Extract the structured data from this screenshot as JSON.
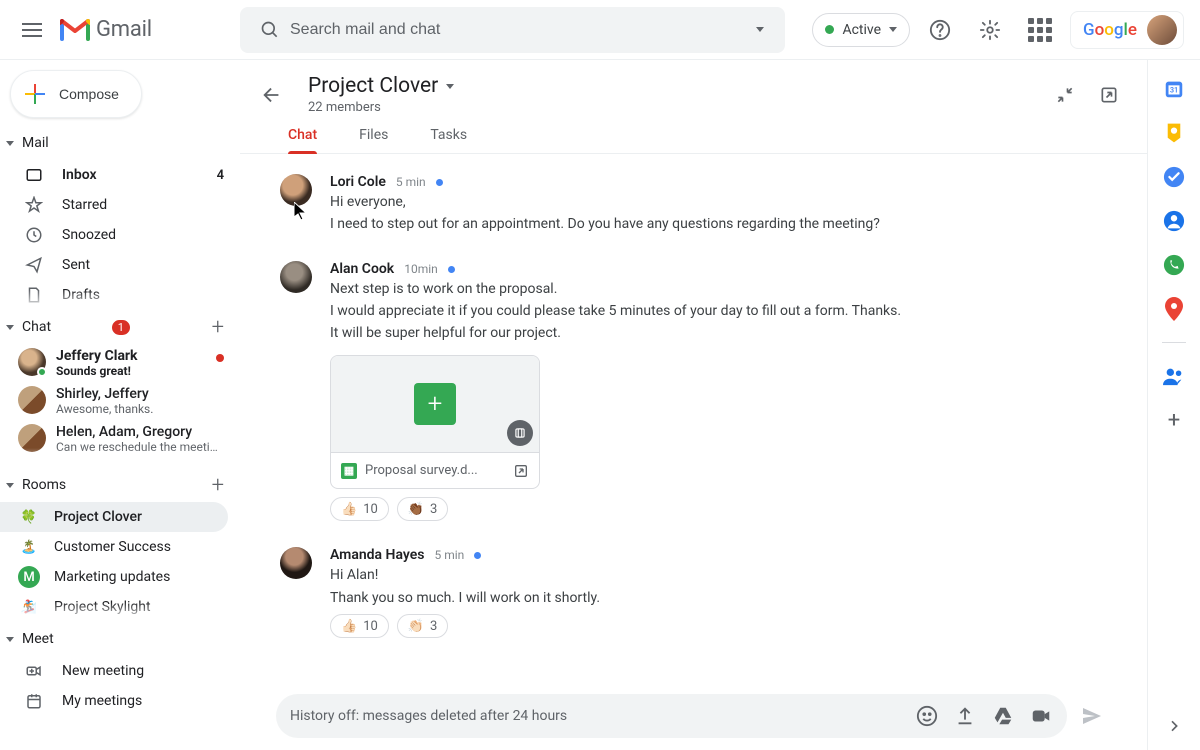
{
  "header": {
    "logo_text": "Gmail",
    "search_placeholder": "Search mail and chat",
    "status_label": "Active"
  },
  "compose_label": "Compose",
  "mail": {
    "header": "Mail",
    "items": [
      {
        "label": "Inbox",
        "count": "4",
        "bold": true
      },
      {
        "label": "Starred"
      },
      {
        "label": "Snoozed"
      },
      {
        "label": "Sent"
      },
      {
        "label": "Drafts"
      }
    ]
  },
  "chat": {
    "header": "Chat",
    "badge": "1",
    "items": [
      {
        "name": "Jeffery Clark",
        "preview": "Sounds great!",
        "unread": true,
        "presence_green": true
      },
      {
        "name": "Shirley, Jeffery",
        "preview": "Awesome, thanks."
      },
      {
        "name": "Helen, Adam, Gregory",
        "preview": "Can we reschedule the meeting to next week?"
      }
    ]
  },
  "rooms": {
    "header": "Rooms",
    "items": [
      {
        "name": "Project Clover",
        "emoji": "🍀",
        "active": true
      },
      {
        "name": "Customer Success",
        "emoji": "🏝️"
      },
      {
        "name": "Marketing updates",
        "emoji": "M",
        "bg": "#34a853",
        "fg": "#fff"
      },
      {
        "name": "Project Skylight",
        "emoji": "🏂"
      }
    ]
  },
  "meet": {
    "header": "Meet",
    "items": [
      {
        "label": "New meeting"
      },
      {
        "label": "My meetings"
      }
    ]
  },
  "room": {
    "title": "Project Clover",
    "subtitle": "22 members",
    "tabs": [
      "Chat",
      "Files",
      "Tasks"
    ],
    "active_tab": 0,
    "messages": [
      {
        "author": "Lori Cole",
        "time": "5 min",
        "lines": [
          "Hi everyone,",
          "I need to step out for an appointment. Do you have any questions regarding the meeting?"
        ]
      },
      {
        "author": "Alan Cook",
        "time": "10min",
        "lines": [
          "Next step is to work on the proposal.",
          "I would appreciate it if you could please take 5 minutes of your day to fill out a form. Thanks.",
          "It will be super helpful for our project."
        ],
        "attachment": {
          "name": "Proposal survey.d..."
        },
        "reactions": [
          {
            "emoji": "👍🏻",
            "count": "10"
          },
          {
            "emoji": "👏🏾",
            "count": "3"
          }
        ]
      },
      {
        "author": "Amanda Hayes",
        "time": "5 min",
        "lines": [
          "Hi Alan!",
          "Thank you so much. I will work on it shortly."
        ],
        "reactions": [
          {
            "emoji": "👍🏻",
            "count": "10"
          },
          {
            "emoji": "👏🏻",
            "count": "3"
          }
        ]
      }
    ],
    "composer_text": "History off: messages deleted after 24 hours"
  }
}
